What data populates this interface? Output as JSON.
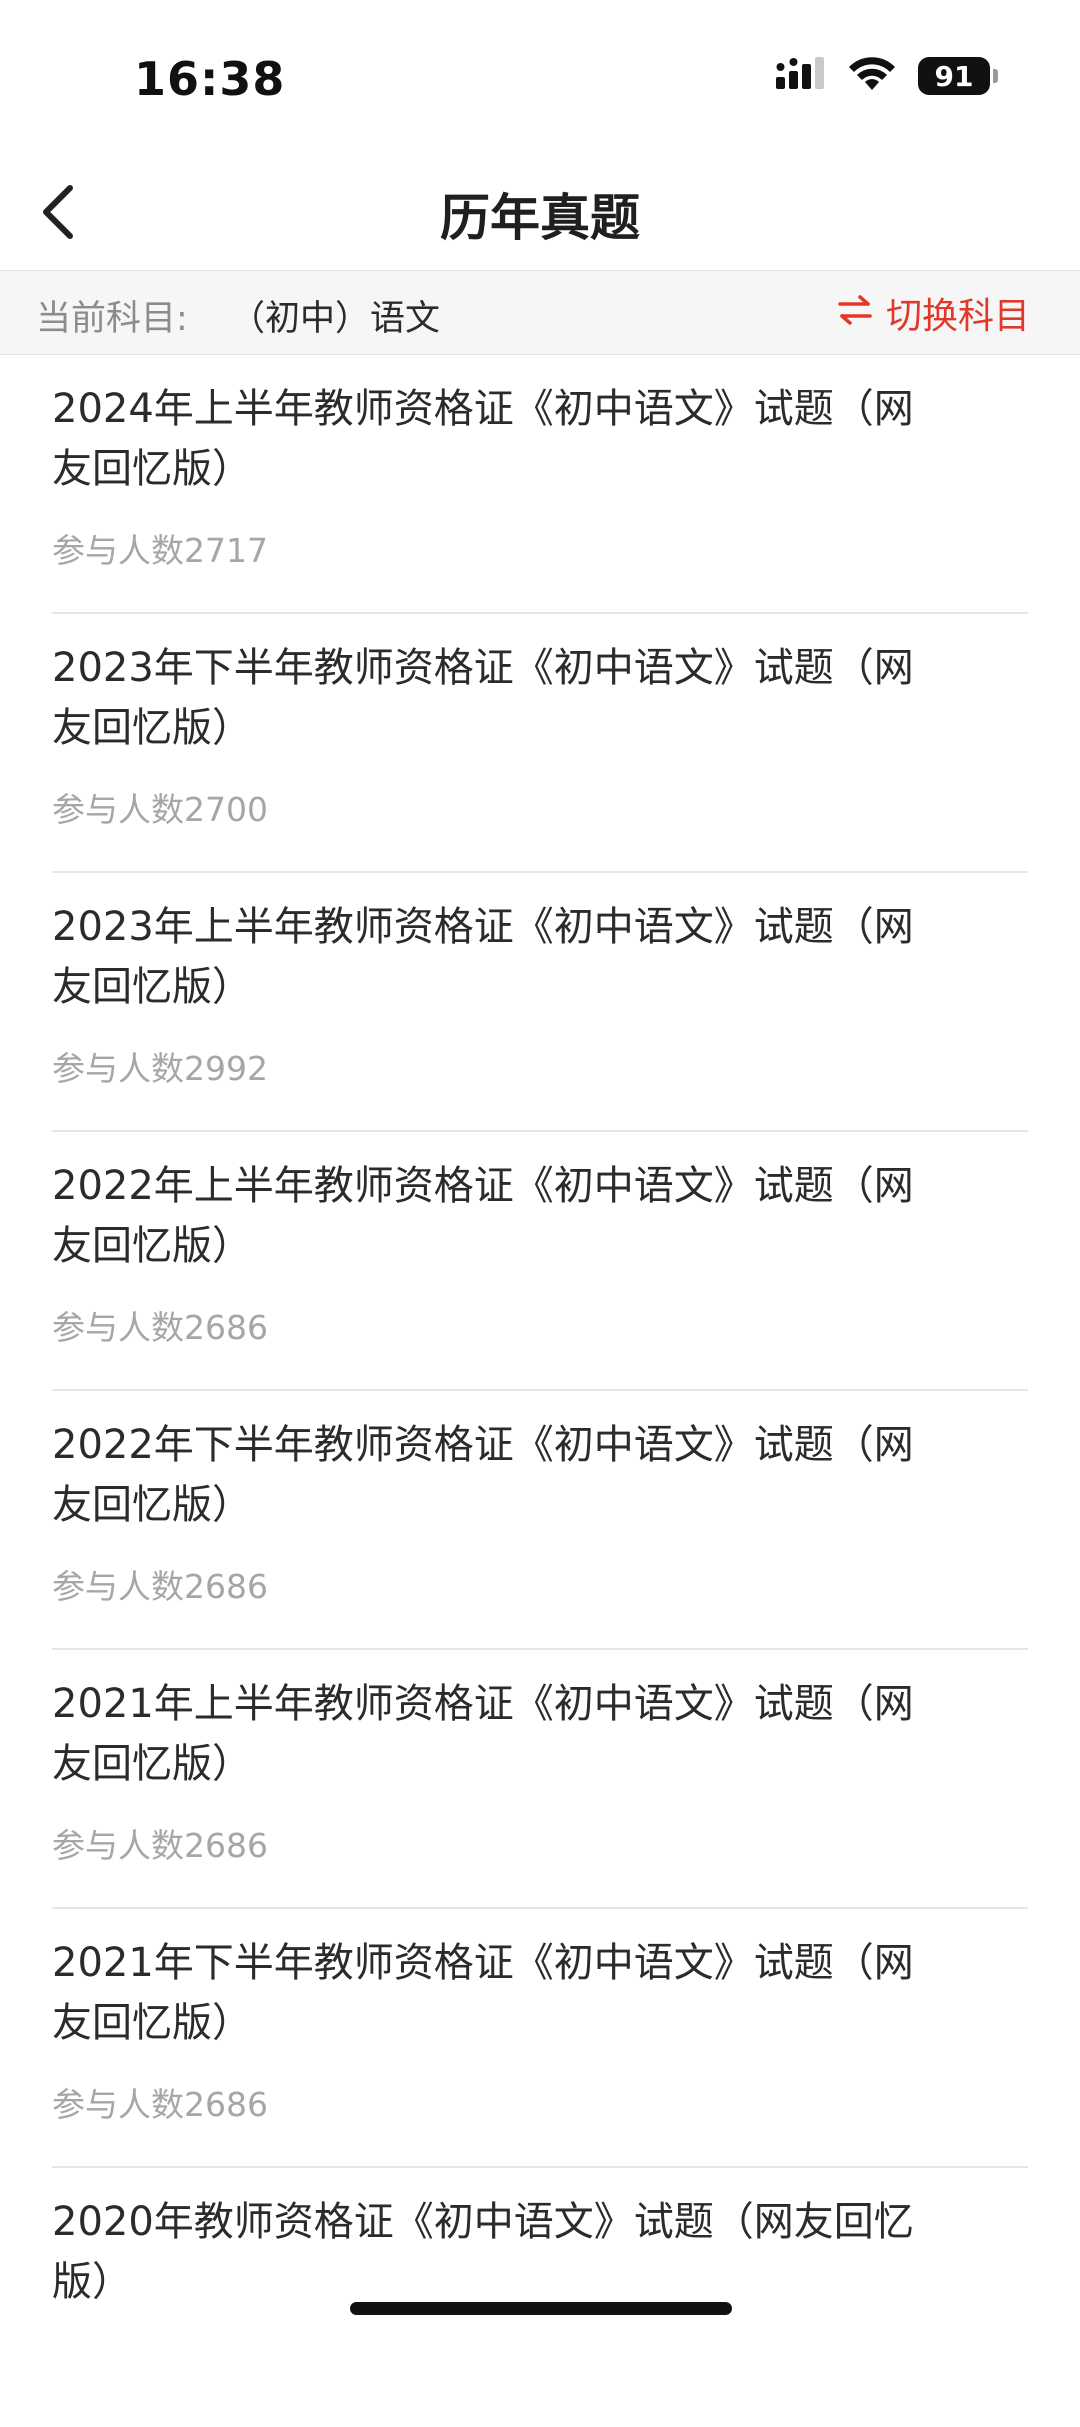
{
  "status_bar": {
    "time": "16:38",
    "battery": "91",
    "icons": [
      "signal-icon",
      "wifi-icon",
      "battery-icon"
    ]
  },
  "nav": {
    "title": "历年真题",
    "back_icon": "chevron-left-icon"
  },
  "subject_bar": {
    "label": "当前科目:",
    "value": "（初中）语文",
    "switch_label": "切换科目",
    "switch_icon": "swap-arrows-icon",
    "accent_color": "#e0392b"
  },
  "papers": [
    {
      "title": "2024年上半年教师资格证《初中语文》试题（网友回忆版）",
      "count": "参与人数2717"
    },
    {
      "title": "2023年下半年教师资格证《初中语文》试题（网友回忆版）",
      "count": "参与人数2700"
    },
    {
      "title": "2023年上半年教师资格证《初中语文》试题（网友回忆版）",
      "count": "参与人数2992"
    },
    {
      "title": "2022年上半年教师资格证《初中语文》试题（网友回忆版）",
      "count": "参与人数2686"
    },
    {
      "title": "2022年下半年教师资格证《初中语文》试题（网友回忆版）",
      "count": "参与人数2686"
    },
    {
      "title": "2021年上半年教师资格证《初中语文》试题（网友回忆版）",
      "count": "参与人数2686"
    },
    {
      "title": "2021年下半年教师资格证《初中语文》试题（网友回忆版）",
      "count": "参与人数2686"
    },
    {
      "title": "2020年教师资格证《初中语文》试题（网友回忆版）",
      "count": ""
    }
  ]
}
